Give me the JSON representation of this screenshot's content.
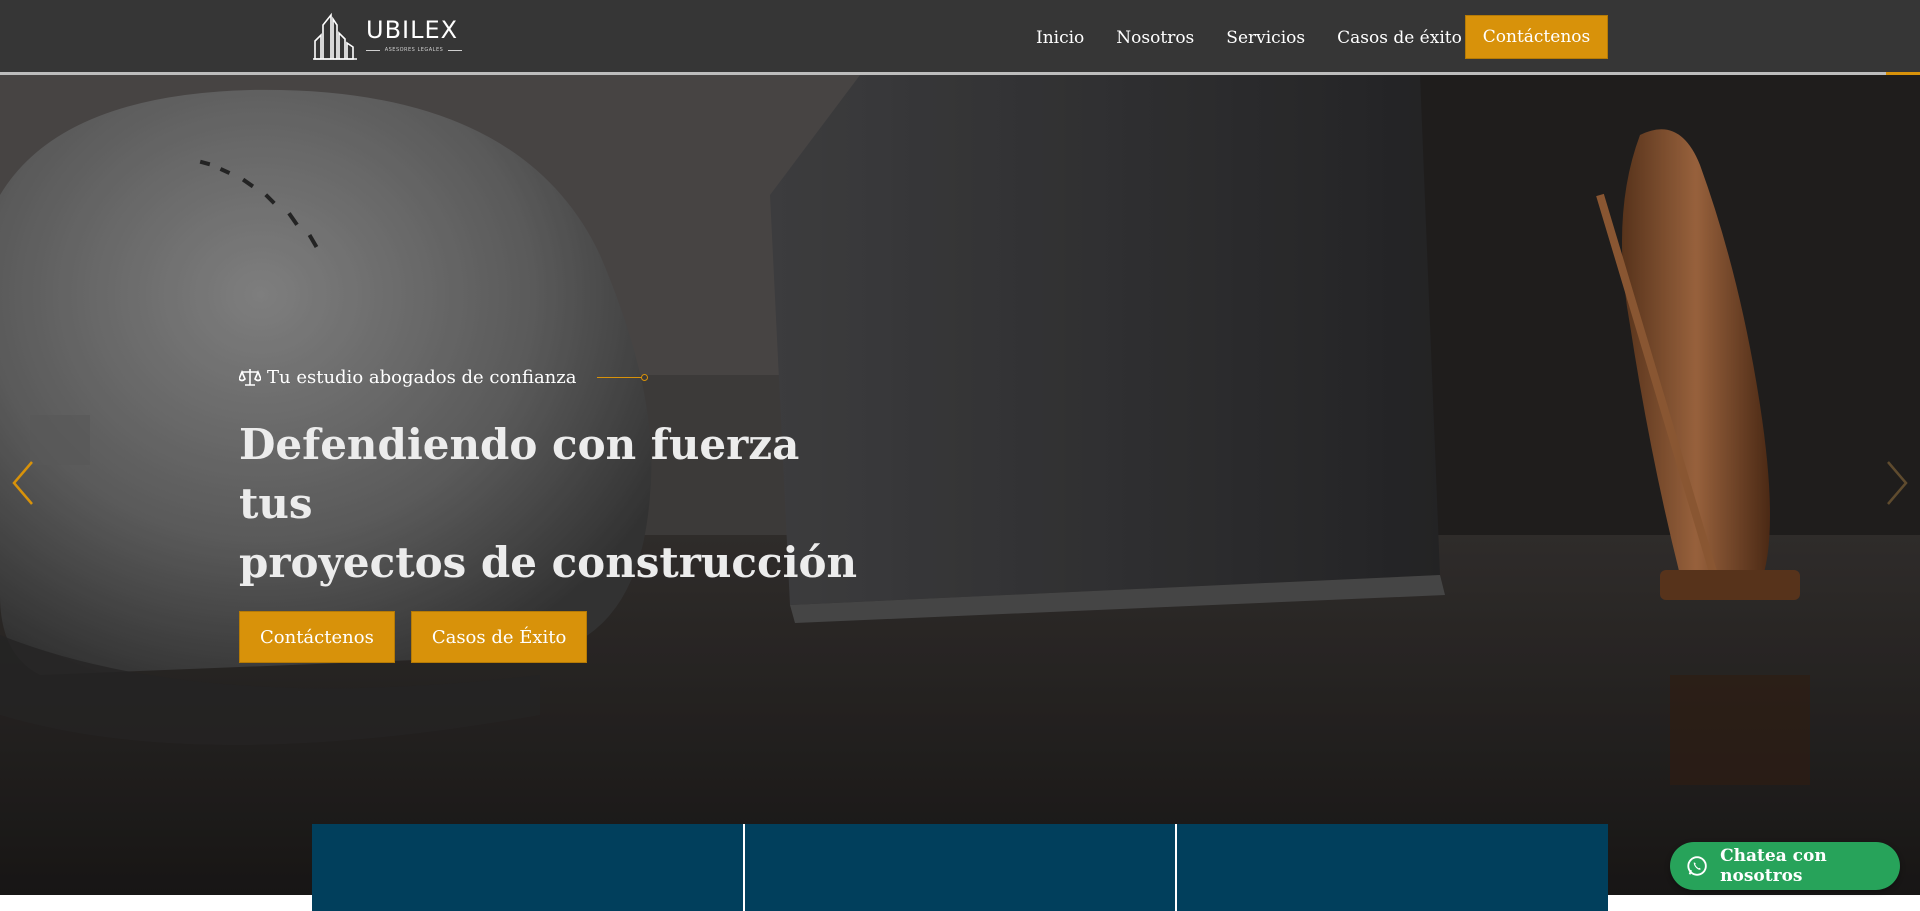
{
  "brand": {
    "name": "UBILEX",
    "tagline": "ASESORES LEGALES"
  },
  "nav": {
    "links": [
      "Inicio",
      "Nosotros",
      "Servicios",
      "Casos de éxito"
    ],
    "cta": "Contáctenos"
  },
  "hero": {
    "eyebrow": "Tu estudio abogados de confianza",
    "title_line1": "Defendiendo con fuerza tus",
    "title_line2": "proyectos de construcción",
    "buttons": [
      "Contáctenos",
      "Casos de Éxito"
    ]
  },
  "whatsapp": {
    "label": "Chatea con nosotros"
  },
  "colors": {
    "accent": "#d8920a",
    "navbar": "#363636",
    "feature_band": "#013f5c",
    "whatsapp": "#27a35a"
  }
}
